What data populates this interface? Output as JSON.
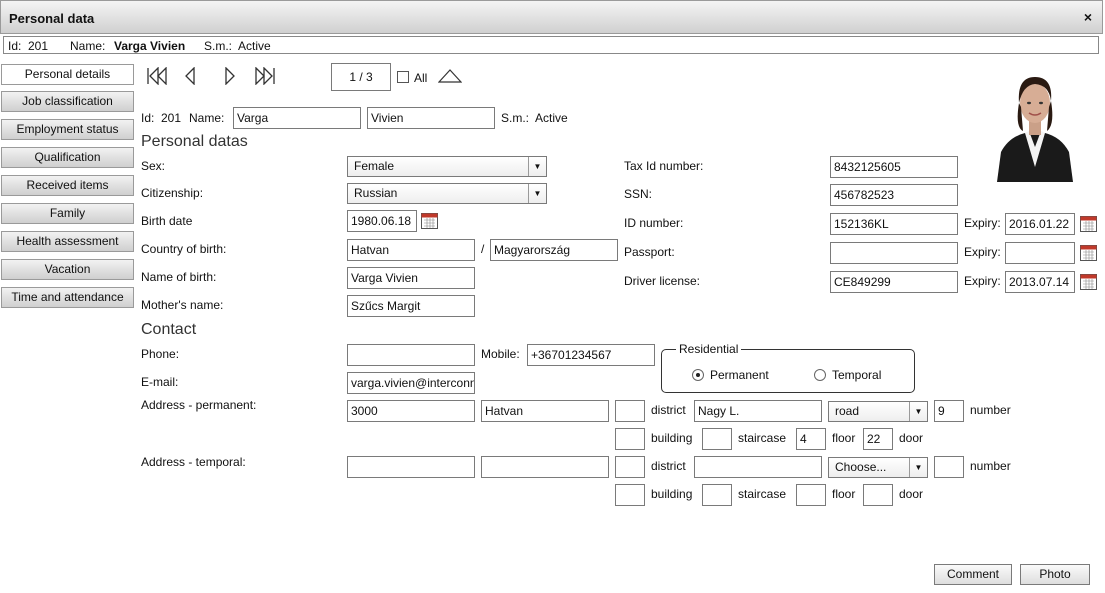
{
  "window": {
    "title": "Personal data",
    "close": "×"
  },
  "info": {
    "id_label": "Id:",
    "id": "201",
    "name_label": "Name:",
    "name": "Varga Vivien",
    "sm_label": "S.m.:",
    "sm": "Active"
  },
  "tabs": [
    "Personal details",
    "Job classification",
    "Employment status",
    "Qualification",
    "Received items",
    "Family",
    "Health assessment",
    "Vacation",
    "Time and attendance"
  ],
  "pager": {
    "value": "1 / 3",
    "all_label": "All"
  },
  "record": {
    "id_label": "Id:",
    "id": "201",
    "name_label": "Name:",
    "last_name": "Varga",
    "first_name": "Vivien",
    "sm_label": "S.m.:",
    "sm": "Active"
  },
  "sections": {
    "personal": "Personal datas",
    "contact": "Contact"
  },
  "personal": {
    "sex_label": "Sex:",
    "sex": "Female",
    "citizenship_label": "Citizenship:",
    "citizenship": "Russian",
    "birth_date_label": "Birth date",
    "birth_date": "1980.06.18",
    "country_label": "Country of birth:",
    "city_of_birth": "Hatvan",
    "slash": "/",
    "country_of_birth": "Magyarország",
    "name_of_birth_label": "Name of birth:",
    "name_of_birth": "Varga Vivien",
    "mother_label": "Mother's name:",
    "mother": "Szűcs Margit",
    "tax_label": "Tax Id number:",
    "tax": "8432125605",
    "ssn_label": "SSN:",
    "ssn": "456782523",
    "idnum_label": "ID number:",
    "idnum": "152136KL",
    "passport_label": "Passport:",
    "passport": "",
    "driver_label": "Driver license:",
    "driver": "CE849299",
    "expiry_label": "Expiry:",
    "id_expiry": "2016.01.22",
    "passport_expiry": "",
    "driver_expiry": "2013.07.14"
  },
  "contact": {
    "phone_label": "Phone:",
    "phone": "",
    "mobile_label": "Mobile:",
    "mobile": "+36701234567",
    "email_label": "E-mail:",
    "email": "varga.vivien@interconn",
    "residential_label": "Residential",
    "permanent_label": "Permanent",
    "temporal_label": "Temporal",
    "addr_perm_label": "Address - permanent:",
    "addr_temp_label": "Address - temporal:",
    "district_label": "district",
    "number_label": "number",
    "building_label": "building",
    "staircase_label": "staircase",
    "floor_label": "floor",
    "door_label": "door",
    "perm": {
      "zip": "3000",
      "city": "Hatvan",
      "district": "",
      "street": "Nagy L.",
      "type": "road",
      "number": "9",
      "building": "",
      "staircase": "",
      "floor": "4",
      "door": "22"
    },
    "temp": {
      "zip": "",
      "city": "",
      "district": "",
      "street": "",
      "type": "Choose...",
      "number": "",
      "building": "",
      "staircase": "",
      "floor": "",
      "door": ""
    }
  },
  "buttons": {
    "comment": "Comment",
    "photo": "Photo"
  }
}
